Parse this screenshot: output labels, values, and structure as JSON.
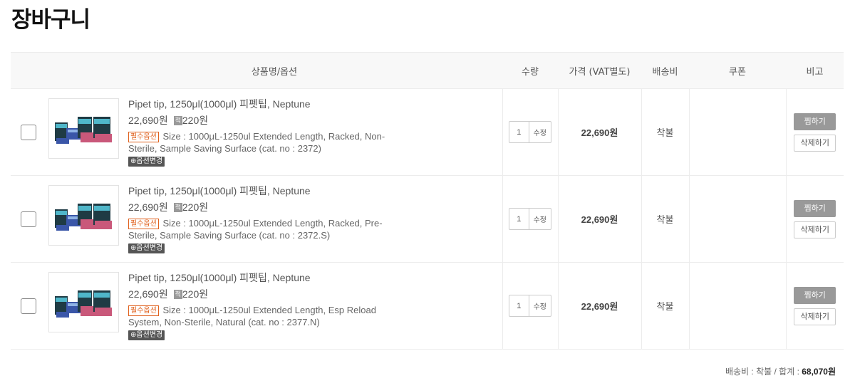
{
  "page_title": "장바구니",
  "table": {
    "headers": {
      "product": "상품명/옵션",
      "quantity": "수량",
      "price": "가격 (VAT별도)",
      "shipping": "배송비",
      "coupon": "쿠폰",
      "note": "비고"
    }
  },
  "items": [
    {
      "name": "Pipet tip, 1250μl(1000μl) 피펫팁, Neptune",
      "price": "22,690원",
      "point_badge": "적",
      "points": "220원",
      "required_badge": "필수옵션",
      "option": "Size : 1000μL-1250ul Extended Length, Racked, Non-Sterile, Sample Saving Surface (cat. no : 2372)",
      "option_change": "옵션변경",
      "qty": "1",
      "qty_edit": "수정",
      "line_price": "22,690원",
      "shipping": "착불",
      "wish_label": "찜하기",
      "delete_label": "삭제하기"
    },
    {
      "name": "Pipet tip, 1250μl(1000μl) 피펫팁, Neptune",
      "price": "22,690원",
      "point_badge": "적",
      "points": "220원",
      "required_badge": "필수옵션",
      "option": "Size : 1000μL-1250ul Extended Length, Racked, Pre-Sterile, Sample Saving Surface (cat. no : 2372.S)",
      "option_change": "옵션변경",
      "qty": "1",
      "qty_edit": "수정",
      "line_price": "22,690원",
      "shipping": "착불",
      "wish_label": "찜하기",
      "delete_label": "삭제하기"
    },
    {
      "name": "Pipet tip, 1250μl(1000μl) 피펫팁, Neptune",
      "price": "22,690원",
      "point_badge": "적",
      "points": "220원",
      "required_badge": "필수옵션",
      "option": "Size : 1000μL-1250ul Extended Length, Esp Reload System, Non-Sterile, Natural (cat. no : 2377.N)",
      "option_change": "옵션변경",
      "qty": "1",
      "qty_edit": "수정",
      "line_price": "22,690원",
      "shipping": "착불",
      "wish_label": "찜하기",
      "delete_label": "삭제하기"
    }
  ],
  "summary": {
    "shipping_label": "배송비 : 착불 / 합계 :",
    "total": "68,070원"
  },
  "colors": {
    "required_badge": "#e0621f",
    "wish_button": "#999999",
    "header_bg": "#f8f8f8"
  }
}
